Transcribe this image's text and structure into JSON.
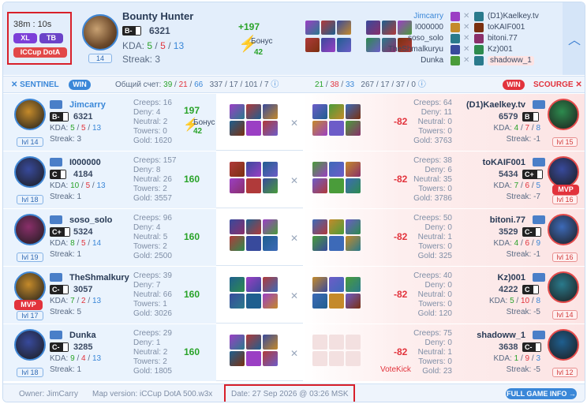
{
  "header": {
    "duration": "38m : 10s",
    "badge_xl": "XL",
    "badge_tb": "TB",
    "badge_mode": "ICCup DotA",
    "player": {
      "name": "Bounty Hunter",
      "rank": "B-",
      "rating": "6321",
      "kda_label": "KDA:",
      "kills": "5",
      "deaths": "5",
      "assists": "13",
      "streak": "Streak: 3",
      "level": "14"
    },
    "delta": "+197",
    "bonus_label": "Бонус",
    "bonus": "42",
    "team_left": [
      "Jimcarry",
      "I000000",
      "soso_solo",
      "TheShmalkuryu",
      "Dunka"
    ],
    "team_right": [
      "(D1)Kaelkey.tv",
      "toKAIF001",
      "bitoni.77",
      "Kz)001",
      "shadoww_1"
    ]
  },
  "colors": {
    "accent": "#3a87d8",
    "red": "#e2333c",
    "green": "#29a329",
    "sentinel": "#eaf3fd",
    "scourge": "#fce4e4"
  },
  "teams": {
    "sentinel": {
      "label": "SENTINEL",
      "result": "WIN",
      "score_label": "Общий счет:",
      "score": [
        "39",
        "21",
        "66"
      ],
      "stats": "337 / 17 / 101 / 7"
    },
    "scourge": {
      "label": "SCOURGE",
      "result": "WIN",
      "score": [
        "21",
        "38",
        "33"
      ],
      "stats": "267 / 17 / 37 / 0"
    }
  },
  "rows": [
    {
      "left": {
        "name": "Jimcarry",
        "rank": "B-",
        "rating": "6321",
        "k": "5",
        "d": "5",
        "a": "13",
        "streak": "Streak: 3",
        "lvl": "lvl 14",
        "creeps": "Creeps: 16",
        "deny": "Deny: 4",
        "neutral": "Neutral: 2",
        "towers": "Towers: 0",
        "gold": "Gold: 1620",
        "delta": "197",
        "bonus_label": "Бонус",
        "bonus": "42"
      },
      "right": {
        "name": "(D1)Kaelkey.tv",
        "rank": "B",
        "rating": "6579",
        "k": "4",
        "d": "7",
        "a": "8",
        "streak": "Streak: -1",
        "lvl": "lvl 15",
        "creeps": "Creeps: 64",
        "deny": "Deny: 11",
        "neutral": "Neutral: 0",
        "towers": "Towers: 0",
        "gold": "Gold: 3763",
        "delta": "-82"
      }
    },
    {
      "left": {
        "name": "I000000",
        "rank": "C",
        "rating": "4184",
        "k": "10",
        "d": "5",
        "a": "13",
        "streak": "Streak: 1",
        "lvl": "lvl 18",
        "creeps": "Creeps: 157",
        "deny": "Deny: 8",
        "neutral": "Neutral: 26",
        "towers": "Towers: 2",
        "gold": "Gold: 3557",
        "delta": "160"
      },
      "right": {
        "name": "toKAIF001",
        "rank": "C+",
        "rating": "5434",
        "k": "7",
        "d": "6",
        "a": "5",
        "streak": "Streak: -7",
        "lvl": "lvl 16",
        "mvp": "MVP",
        "creeps": "Creeps: 38",
        "deny": "Deny: 6",
        "neutral": "Neutral: 35",
        "towers": "Towers: 0",
        "gold": "Gold: 3786",
        "delta": "-82"
      }
    },
    {
      "left": {
        "name": "soso_solo",
        "rank": "C+",
        "rating": "5324",
        "k": "8",
        "d": "5",
        "a": "14",
        "streak": "Streak: 1",
        "lvl": "lvl 19",
        "creeps": "Creeps: 96",
        "deny": "Deny: 4",
        "neutral": "Neutral: 5",
        "towers": "Towers: 2",
        "gold": "Gold: 2500",
        "delta": "160"
      },
      "right": {
        "name": "bitoni.77",
        "rank": "C-",
        "rating": "3529",
        "k": "4",
        "d": "6",
        "a": "9",
        "streak": "Streak: -1",
        "lvl": "lvl 16",
        "creeps": "Creeps: 50",
        "deny": "Deny: 0",
        "neutral": "Neutral: 1",
        "towers": "Towers: 0",
        "gold": "Gold: 325",
        "delta": "-82"
      }
    },
    {
      "left": {
        "name": "TheShmalkury",
        "rank": "C-",
        "rating": "3057",
        "k": "7",
        "d": "2",
        "a": "13",
        "streak": "Streak: 5",
        "lvl": "lvl 17",
        "mvp": "MVP",
        "creeps": "Creeps: 39",
        "deny": "Deny: 7",
        "neutral": "Neutral: 66",
        "towers": "Towers: 1",
        "gold": "Gold: 3026",
        "delta": "160"
      },
      "right": {
        "name": "Kz)001",
        "rank": "C",
        "rating": "4222",
        "k": "5",
        "d": "10",
        "a": "8",
        "streak": "Streak: -5",
        "lvl": "lvl 14",
        "creeps": "Creeps: 40",
        "deny": "Deny: 0",
        "neutral": "Neutral: 0",
        "towers": "Towers: 0",
        "gold": "Gold: 120",
        "delta": "-82"
      }
    },
    {
      "left": {
        "name": "Dunka",
        "rank": "C-",
        "rating": "3285",
        "k": "9",
        "d": "4",
        "a": "13",
        "streak": "Streak: 1",
        "lvl": "lvl 18",
        "creeps": "Creeps: 29",
        "deny": "Deny: 1",
        "neutral": "Neutral: 2",
        "towers": "Towers: 2",
        "gold": "Gold: 1805",
        "delta": "160"
      },
      "right": {
        "name": "shadoww_1",
        "rank": "C-",
        "rating": "3638",
        "k": "1",
        "d": "9",
        "a": "3",
        "streak": "Streak: -5",
        "lvl": "lvl 12",
        "creeps": "Creeps: 75",
        "deny": "Deny: 0",
        "neutral": "Neutral: 1",
        "towers": "Towers: 0",
        "gold": "Gold: 23",
        "delta": "-82",
        "note": "VoteKick"
      }
    }
  ],
  "footer": {
    "owner": "Owner: JimCarry",
    "map": "Map version: iCCup DotA 500.w3x",
    "date": "Date: 27 Sep 2026 @ 03:26 MSK",
    "full_info": "FULL GAME INFO →"
  }
}
